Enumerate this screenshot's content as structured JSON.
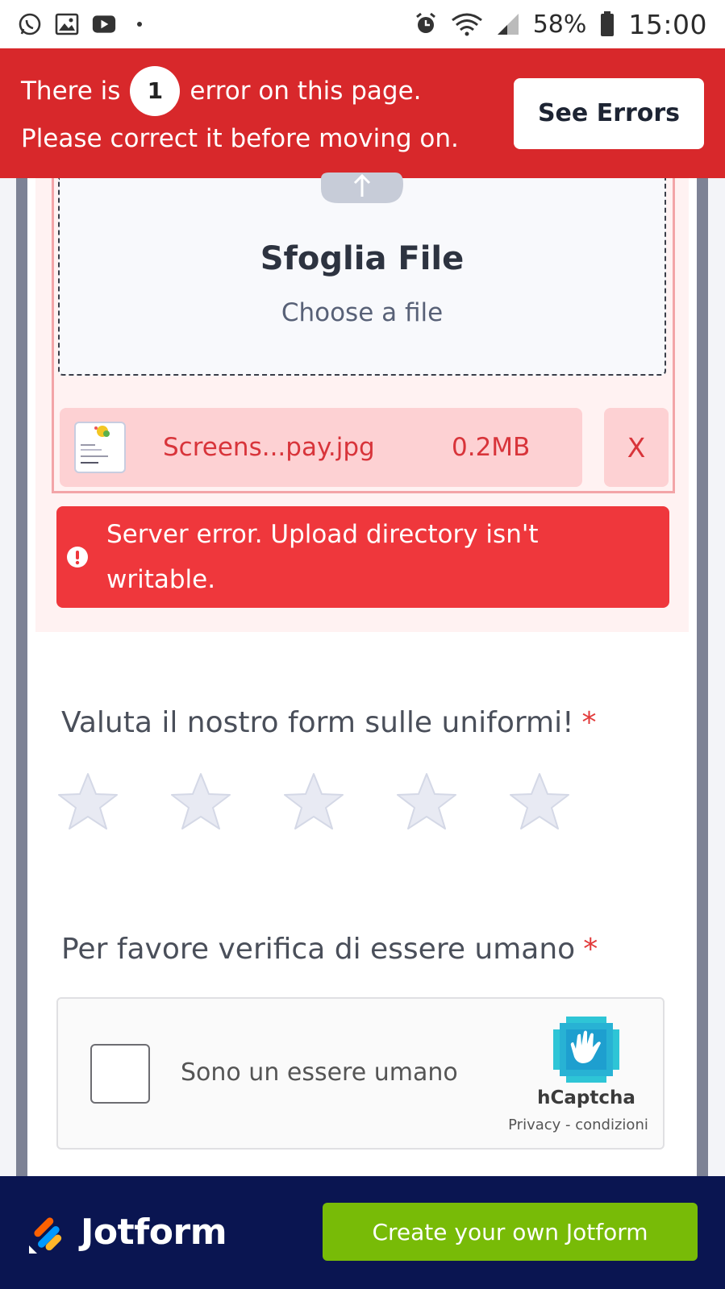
{
  "status_bar": {
    "time": "15:00",
    "battery": "58%",
    "icons_left": [
      "whatsapp-icon",
      "gallery-icon",
      "youtube-icon",
      "dot-icon"
    ],
    "icons_right": [
      "alarm-icon",
      "wifi-icon",
      "signal-icon",
      "battery-icon"
    ]
  },
  "error_banner": {
    "line1_prefix": "There is",
    "error_count": "1",
    "line1_suffix": "error on this page.",
    "line2": "Please correct it before moving on.",
    "see_errors_label": "See Errors"
  },
  "upload": {
    "title": "Sfoglia File",
    "subtitle": "Choose a file",
    "file": {
      "name": "Screens...pay.jpg",
      "size": "0.2MB",
      "remove_label": "X"
    },
    "error_message": "Server error. Upload directory isn't writable."
  },
  "rating": {
    "label": "Valuta il nostro form sulle uniformi!",
    "required_mark": "*",
    "max_stars": 5,
    "selected": 0
  },
  "captcha": {
    "label": "Per favore verifica di essere umano",
    "required_mark": "*",
    "checkbox_label": "Sono un essere umano",
    "brand": "hCaptcha",
    "links": "Privacy - condizioni"
  },
  "footer": {
    "brand": "Jotform",
    "cta_label": "Create your own Jotform"
  },
  "colors": {
    "banner_red": "#d8282b",
    "error_red": "#ef373c",
    "file_row_pink": "#fdd1d3",
    "footer_navy": "#0a1551",
    "cta_green": "#78bb07"
  }
}
